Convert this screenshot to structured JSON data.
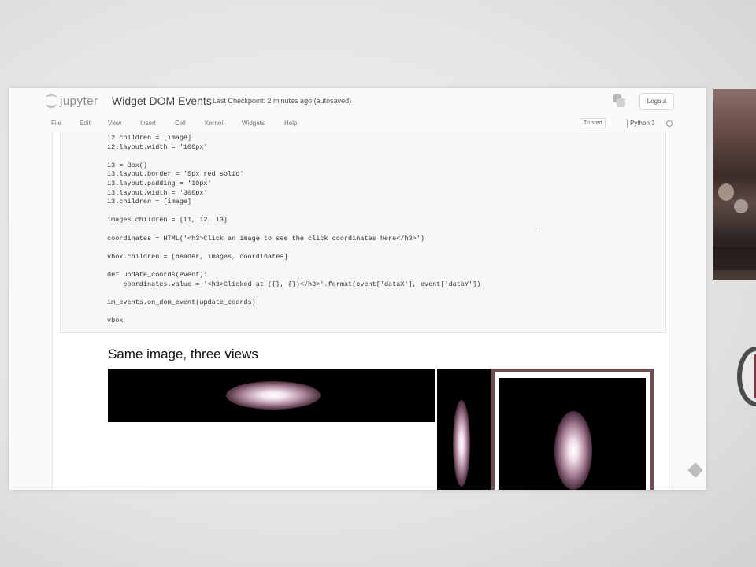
{
  "header": {
    "logo_text": "jupyter",
    "notebook_title": "Widget DOM Events",
    "checkpoint": "Last Checkpoint: 2 minutes ago",
    "autosave": "(autosaved)",
    "logout_label": "Logout"
  },
  "menu": {
    "items": [
      "File",
      "Edit",
      "View",
      "Insert",
      "Cell",
      "Kernel",
      "Widgets",
      "Help"
    ],
    "trusted_label": "Trusted",
    "kernel_name": "Python 3"
  },
  "cell": {
    "code": "i2.children = [image]\ni2.layout.width = '100px'\n\ni3 = Box()\ni3.layout.border = '5px red solid'\ni3.layout.padding = '10px'\ni3.layout.width = '300px'\ni3.children = [image]\n\nimages.children = [i1, i2, i3]\n\ncoordinates = HTML('<h3>Click an image to see the click coordinates here</h3>')\n\nvbox.children = [header, images, coordinates]\n\ndef update_coords(event):\n    coordinates.value = '<h3>Clicked at ({}, {})</h3>'.format(event['dataX'], event['dataY'])\n\nim_events.on_dom_event(update_coords)\n\nvbox"
  },
  "output": {
    "title": "Same image, three views"
  },
  "icons": {
    "python_logo": "python-icon",
    "cursor": "text-cursor-icon"
  }
}
